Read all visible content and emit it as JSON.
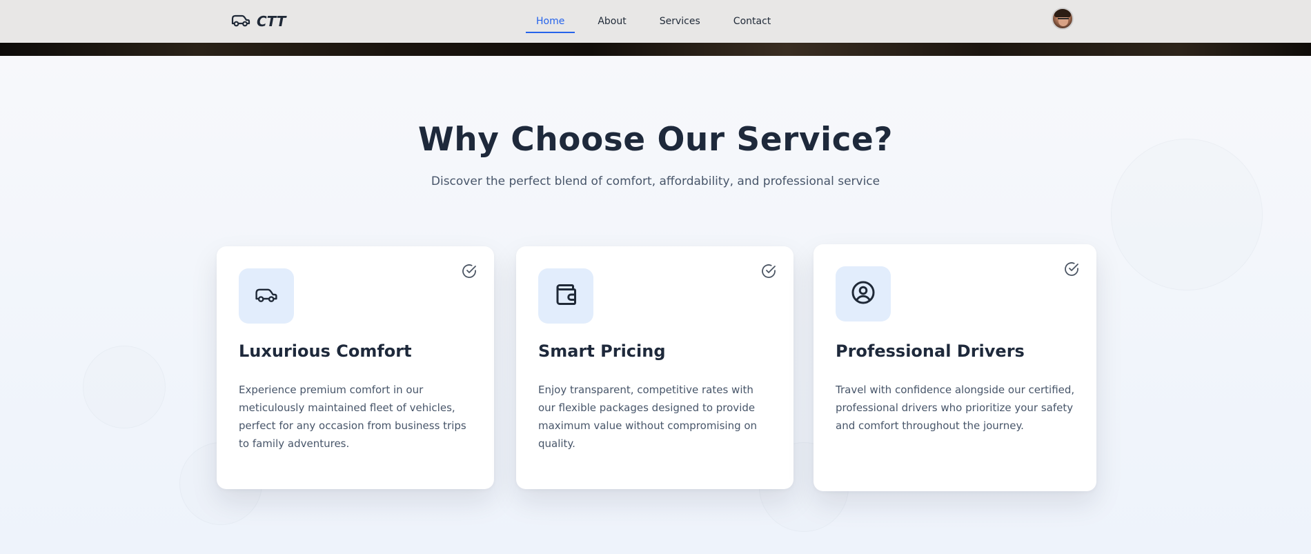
{
  "header": {
    "logo_text": "CTT",
    "logo_icon": "car-icon",
    "nav": [
      {
        "label": "Home",
        "active": true
      },
      {
        "label": "About",
        "active": false
      },
      {
        "label": "Services",
        "active": false
      },
      {
        "label": "Contact",
        "active": false
      }
    ],
    "avatar": "user-avatar"
  },
  "section": {
    "title": "Why Choose Our Service?",
    "subtitle": "Discover the perfect blend of comfort, affordability, and professional service"
  },
  "cards": [
    {
      "icon": "car-icon",
      "title": "Luxurious Comfort",
      "description": "Experience premium comfort in our meticulously maintained fleet of vehicles, perfect for any occasion from business trips to family adventures."
    },
    {
      "icon": "wallet-icon",
      "title": "Smart Pricing",
      "description": "Enjoy transparent, competitive rates with our flexible packages designed to provide maximum value without compromising on quality."
    },
    {
      "icon": "user-circle-icon",
      "title": "Professional Drivers",
      "description": "Travel with confidence alongside our certified, professional drivers who prioritize your safety and comfort throughout the journey."
    }
  ],
  "colors": {
    "accent": "#2563eb",
    "icon_bg": "#e2edfc",
    "text_dark": "#1e293b",
    "text_muted": "#475569"
  }
}
